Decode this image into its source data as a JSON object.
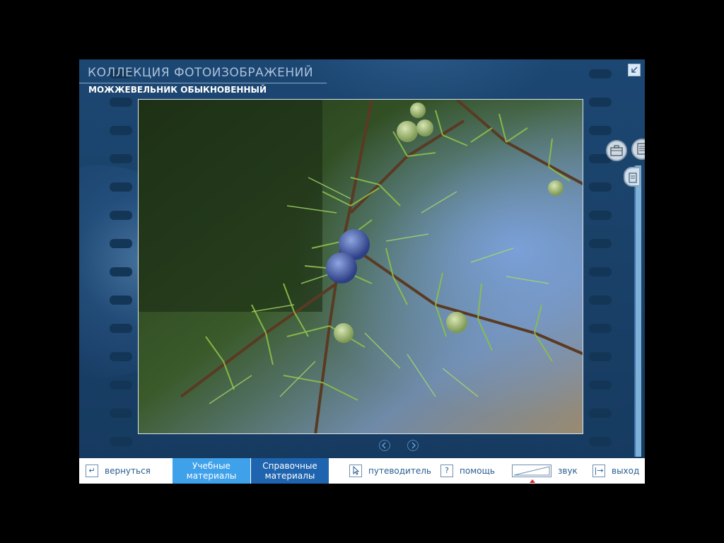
{
  "header": {
    "title": "КОЛЛЕКЦИЯ ФОТОИЗОБРАЖЕНИЙ",
    "subtitle": "МОЖЖЕВЕЛЬНИК ОБЫКНОВЕННЫЙ"
  },
  "colors": {
    "background": "#000000",
    "panel": "#1c4773",
    "active_tab": "#3ea1ea",
    "ref_tab": "#1f64ae",
    "link_text": "#2a5e90"
  },
  "icons": {
    "corner": "minimize-arrow-icon",
    "side_a": "briefcase-icon",
    "side_b": "document-icon",
    "side_c": "clipboard-icon",
    "prev": "chevron-left-icon",
    "next": "chevron-right-icon"
  },
  "bottom": {
    "back_label": "вернуться",
    "back_icon": "↵",
    "tab_study_line1": "Учебные",
    "tab_study_line2": "материалы",
    "tab_ref_line1": "Справочные",
    "tab_ref_line2": "материалы",
    "guide_label": "путеводитель",
    "help_label": "помощь",
    "help_icon": "?",
    "sound_label": "звук",
    "exit_label": "выход",
    "exit_icon": "|→"
  }
}
